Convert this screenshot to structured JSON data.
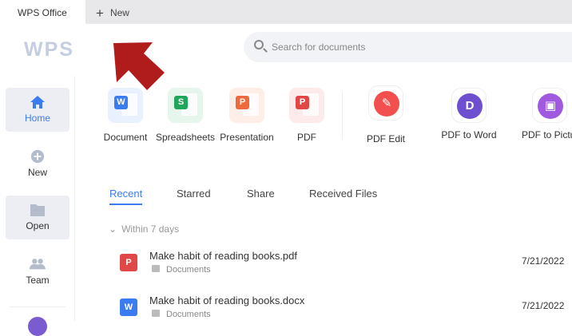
{
  "tabs": {
    "active": "WPS Office",
    "new": "New"
  },
  "logo": "WPS",
  "search": {
    "placeholder": "Search for documents"
  },
  "sidebar": [
    {
      "label": "Home"
    },
    {
      "label": "New"
    },
    {
      "label": "Open"
    },
    {
      "label": "Team"
    }
  ],
  "create": [
    {
      "label": "Document",
      "glyph": "W",
      "color": "#3b7cf0"
    },
    {
      "label": "Spreadsheets",
      "glyph": "S",
      "color": "#1ea65a"
    },
    {
      "label": "Presentation",
      "glyph": "P",
      "color": "#ee6a3c"
    },
    {
      "label": "PDF",
      "glyph": "P",
      "color": "#e04848"
    }
  ],
  "tools": [
    {
      "label": "PDF Edit",
      "color": "#f2504f"
    },
    {
      "label": "PDF to Word",
      "color": "#6d4fd0"
    },
    {
      "label": "PDF to Picture",
      "color": "#a05ae0"
    }
  ],
  "file_tabs": [
    "Recent",
    "Starred",
    "Share",
    "Received Files"
  ],
  "group": "Within 7 days",
  "files": [
    {
      "name": "Make habit of reading books.pdf",
      "location": "Documents",
      "date": "7/21/2022"
    },
    {
      "name": "Make habit of reading books.docx",
      "location": "Documents",
      "date": "7/21/2022"
    }
  ]
}
